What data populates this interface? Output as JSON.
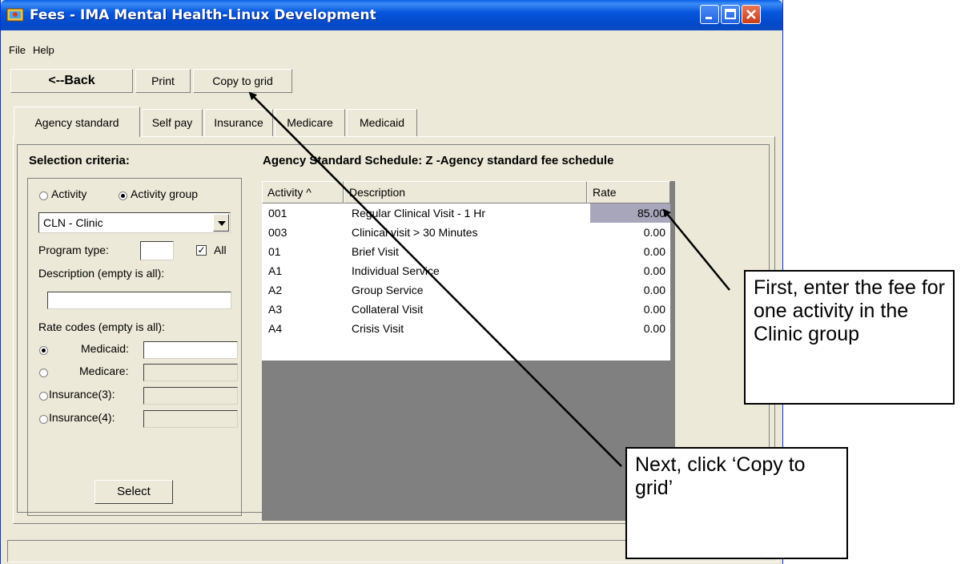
{
  "window": {
    "title": "Fees - IMA Mental Health-Linux Development"
  },
  "menu": {
    "file": "File",
    "help": "Help"
  },
  "toolbar": {
    "back": "<--Back",
    "print": "Print",
    "copy": "Copy to grid"
  },
  "tabs": [
    "Agency standard",
    "Self pay",
    "Insurance",
    "Medicare",
    "Medicaid"
  ],
  "selection": {
    "title": "Selection criteria:",
    "radio_activity": "Activity",
    "radio_activity_group": "Activity group",
    "combo_value": "CLN - Clinic",
    "program_type_label": "Program type:",
    "all_label": "All",
    "description_label": "Description (empty is all):",
    "rate_codes_label": "Rate codes (empty is all):",
    "medicaid": "Medicaid:",
    "medicare": "Medicare:",
    "insurance3": "Insurance(3):",
    "insurance4": "Insurance(4):",
    "select": "Select"
  },
  "schedule_title": "Agency Standard Schedule: Z -Agency standard fee schedule",
  "grid": {
    "headers": {
      "activity": "Activity ^",
      "description": "Description",
      "rate": "Rate"
    },
    "rows": [
      {
        "activity": "001",
        "description": "Regular Clinical Visit - 1 Hr",
        "rate": "85.00"
      },
      {
        "activity": "003",
        "description": "Clinical visit > 30 Minutes",
        "rate": "0.00"
      },
      {
        "activity": "01",
        "description": "Brief Visit",
        "rate": "0.00"
      },
      {
        "activity": "A1",
        "description": "Individual Service",
        "rate": "0.00"
      },
      {
        "activity": "A2",
        "description": "Group Service",
        "rate": "0.00"
      },
      {
        "activity": "A3",
        "description": "Collateral Visit",
        "rate": "0.00"
      },
      {
        "activity": "A4",
        "description": "Crisis Visit",
        "rate": "0.00"
      }
    ]
  },
  "callouts": {
    "first": "First, enter the fee for one activity in the Clinic group",
    "next": "Next, click ‘Copy to grid’"
  }
}
